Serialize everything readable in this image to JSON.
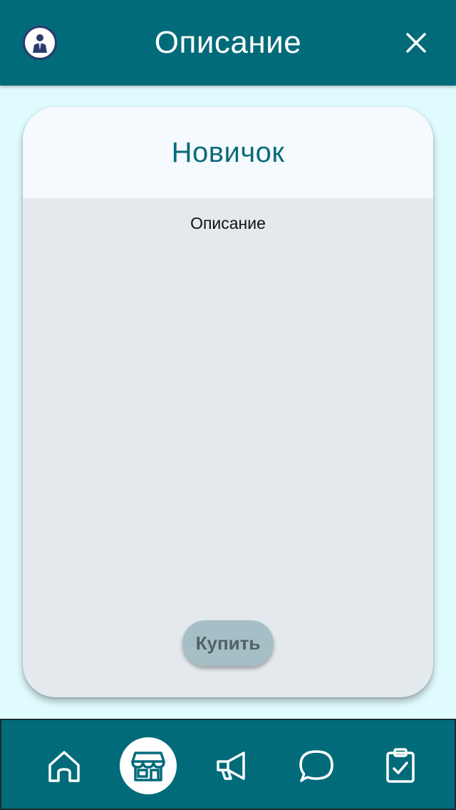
{
  "header": {
    "title": "Описание",
    "avatar_icon": "businessman-avatar-icon",
    "close_icon": "close-icon"
  },
  "card": {
    "title": "Новичок",
    "description": "Описание",
    "buy_label": "Купить"
  },
  "bottom_nav": {
    "items": [
      {
        "icon": "home-icon",
        "active": false
      },
      {
        "icon": "store-icon",
        "active": true
      },
      {
        "icon": "megaphone-icon",
        "active": false
      },
      {
        "icon": "chat-bubble-icon",
        "active": false
      },
      {
        "icon": "clipboard-check-icon",
        "active": false
      }
    ]
  },
  "colors": {
    "primary": "#016b7a",
    "background": "#e0fbfd",
    "card_body": "#e3e9ec",
    "card_header": "#f4fafd",
    "card_title": "#0c6a7c",
    "button_bg": "#a6bfc6",
    "button_text": "#4f6266"
  }
}
